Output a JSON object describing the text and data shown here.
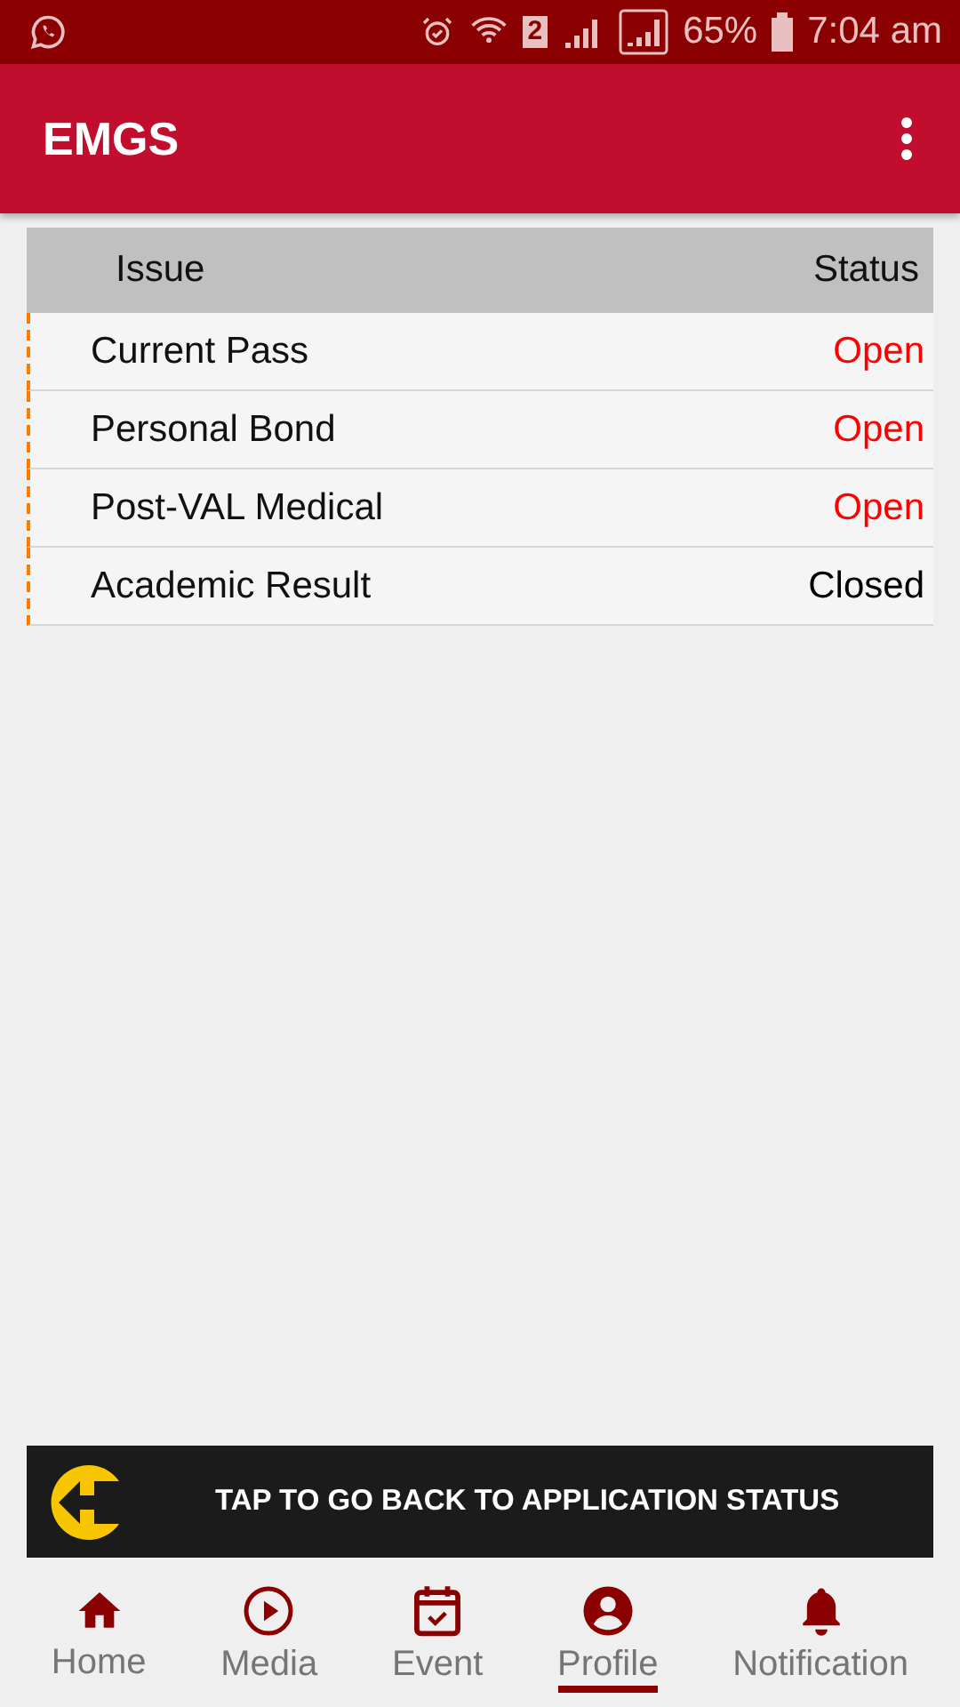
{
  "status_bar": {
    "sim": "2",
    "battery": "65%",
    "time": "7:04 am"
  },
  "app_bar": {
    "title": "EMGS"
  },
  "table": {
    "columns": [
      "Issue",
      "Status"
    ],
    "rows": [
      {
        "issue": "Current Pass",
        "status": "Open",
        "color": "#ff0000"
      },
      {
        "issue": "Personal Bond",
        "status": "Open",
        "color": "#ff0000"
      },
      {
        "issue": "Post-VAL Medical",
        "status": "Open",
        "color": "#ff0000"
      },
      {
        "issue": "Academic Result",
        "status": "Closed",
        "color": "#000000"
      }
    ]
  },
  "banner": {
    "text": "TAP TO GO BACK TO APPLICATION STATUS"
  },
  "nav": [
    {
      "kind": "home",
      "label": "Home",
      "selected": false
    },
    {
      "kind": "media",
      "label": "Media",
      "selected": false
    },
    {
      "kind": "event",
      "label": "Event",
      "selected": false
    },
    {
      "kind": "profile",
      "label": "Profile",
      "selected": true
    },
    {
      "kind": "notification",
      "label": "Notification",
      "selected": false
    }
  ]
}
